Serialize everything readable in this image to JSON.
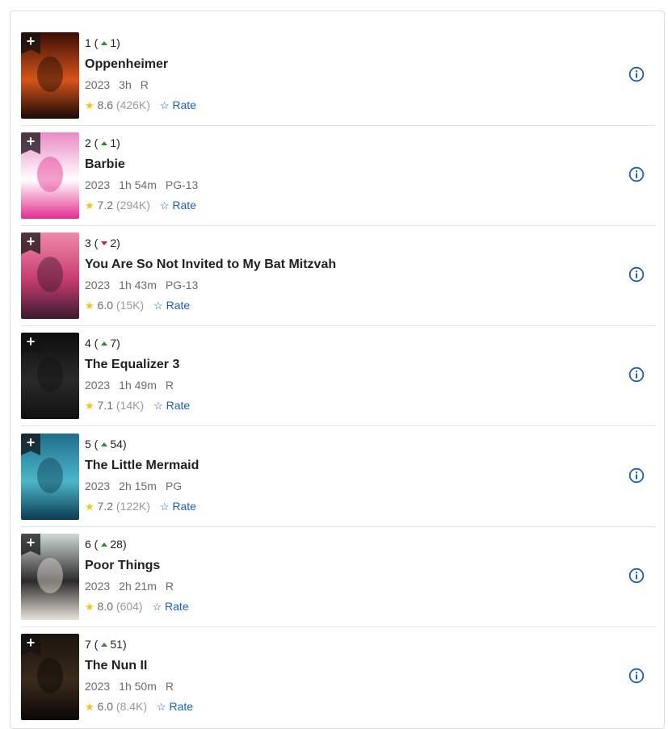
{
  "movies": [
    {
      "rank": "1",
      "dir": "up",
      "change": "1",
      "title": "Oppenheimer",
      "year": "2023",
      "length": "3h",
      "cert": "R",
      "rating": "8.6",
      "votes": "(426K)",
      "rate_label": "Rate",
      "poster_colors": [
        "#3a0d05",
        "#d6541a",
        "#1a0a05"
      ]
    },
    {
      "rank": "2",
      "dir": "up",
      "change": "1",
      "title": "Barbie",
      "year": "2023",
      "length": "1h 54m",
      "cert": "PG-13",
      "rating": "7.2",
      "votes": "(294K)",
      "rate_label": "Rate",
      "poster_colors": [
        "#e88cc4",
        "#ffffff",
        "#e52d8f"
      ]
    },
    {
      "rank": "3",
      "dir": "down",
      "change": "2",
      "title": "You Are So Not Invited to My Bat Mitzvah",
      "year": "2023",
      "length": "1h 43m",
      "cert": "PG-13",
      "rating": "6.0",
      "votes": "(15K)",
      "rate_label": "Rate",
      "poster_colors": [
        "#f08aa9",
        "#c63b6f",
        "#3a1b2e"
      ]
    },
    {
      "rank": "4",
      "dir": "up",
      "change": "7",
      "title": "The Equalizer 3",
      "year": "2023",
      "length": "1h 49m",
      "cert": "R",
      "rating": "7.1",
      "votes": "(14K)",
      "rate_label": "Rate",
      "poster_colors": [
        "#0d0d0d",
        "#2a2a2a",
        "#111111"
      ]
    },
    {
      "rank": "5",
      "dir": "up",
      "change": "54",
      "title": "The Little Mermaid",
      "year": "2023",
      "length": "2h 15m",
      "cert": "PG",
      "rating": "7.2",
      "votes": "(122K)",
      "rate_label": "Rate",
      "poster_colors": [
        "#1f6d8a",
        "#4cb6c9",
        "#0d3c52"
      ]
    },
    {
      "rank": "6",
      "dir": "up",
      "change": "28",
      "title": "Poor Things",
      "year": "2023",
      "length": "2h 21m",
      "cert": "R",
      "rating": "8.0",
      "votes": "(604)",
      "rate_label": "Rate",
      "poster_colors": [
        "#cfd9d6",
        "#2b2b2b",
        "#e9e3da"
      ]
    },
    {
      "rank": "7",
      "dir": "up",
      "change": "51",
      "title": "The Nun II",
      "year": "2023",
      "length": "1h 50m",
      "cert": "R",
      "rating": "6.0",
      "votes": "(8.4K)",
      "rate_label": "Rate",
      "poster_colors": [
        "#1c140e",
        "#3a2a1c",
        "#0a0705"
      ]
    }
  ],
  "add_label": "+",
  "icons": {
    "watchlist": "plus-icon",
    "rating": "star-icon",
    "rate": "star-outline-icon",
    "info": "info-icon"
  },
  "colors": {
    "star": "#f5c518",
    "link": "#1b5fb5",
    "up": "#2e8b2e",
    "down": "#d21f1f"
  }
}
